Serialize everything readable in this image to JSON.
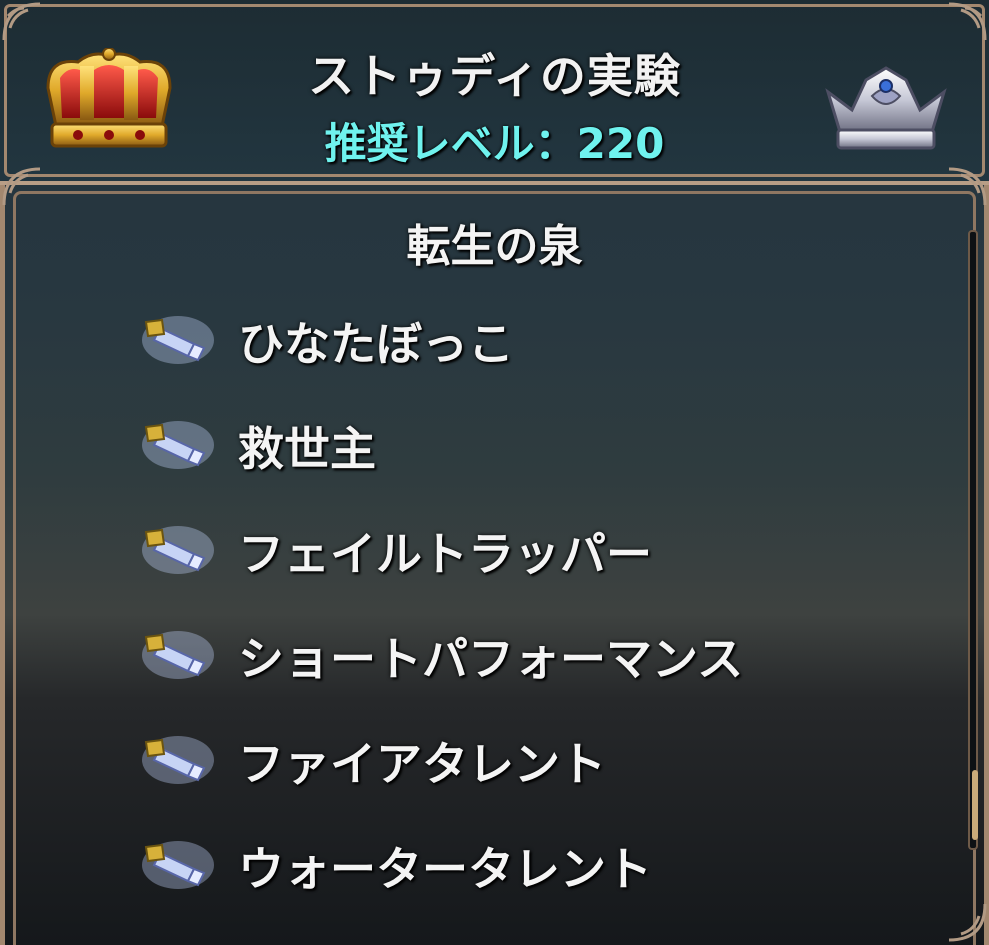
{
  "header": {
    "title": "ストゥディの実験",
    "recommended_level": "推奨レベル：220",
    "left_crown_icon": "gold-crown",
    "right_crown_icon": "silver-crown"
  },
  "panel": {
    "subtitle": "転生の泉",
    "items": [
      {
        "label": "ひなたぼっこ",
        "icon": "crystal-scroll-icon"
      },
      {
        "label": "救世主",
        "icon": "crystal-scroll-icon"
      },
      {
        "label": "フェイルトラッパー",
        "icon": "crystal-scroll-icon"
      },
      {
        "label": "ショートパフォーマンス",
        "icon": "crystal-scroll-icon"
      },
      {
        "label": "ファイアタレント",
        "icon": "crystal-scroll-icon"
      },
      {
        "label": "ウォータータレント",
        "icon": "crystal-scroll-icon"
      }
    ]
  },
  "colors": {
    "level_text": "#6ff2ee",
    "frame": "#a3886f",
    "scroll_thumb": "#c9ab7a"
  }
}
